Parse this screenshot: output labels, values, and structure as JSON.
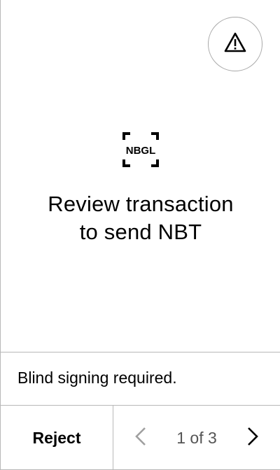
{
  "header": {
    "warning_icon": "warning-triangle-icon"
  },
  "logo": {
    "text": "NBGL"
  },
  "main": {
    "title_line1": "Review transaction",
    "title_line2": "to send NBT"
  },
  "notice": {
    "text": "Blind signing required."
  },
  "footer": {
    "reject_label": "Reject",
    "pager_text": "1 of 3",
    "prev_icon": "chevron-left-icon",
    "next_icon": "chevron-right-icon"
  },
  "colors": {
    "divider": "#b8b8b8",
    "pager_text": "#555555",
    "prev_disabled": "#a0a0a0",
    "text": "#000000"
  }
}
